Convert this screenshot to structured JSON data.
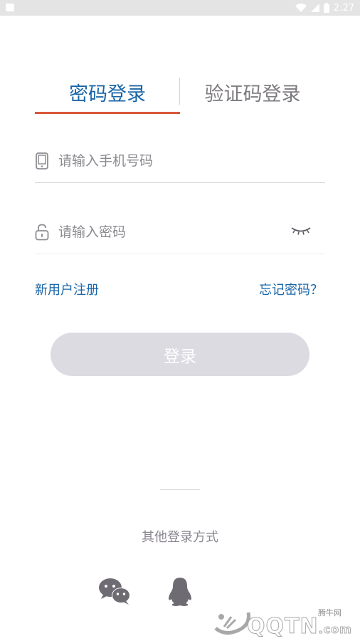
{
  "status_bar": {
    "time": "2:27",
    "icons": [
      "notification-icon",
      "wifi-icon",
      "signal-icon",
      "battery-icon"
    ]
  },
  "tabs": {
    "password_login": "密码登录",
    "code_login": "验证码登录",
    "active": "password_login",
    "accent_color": "#d9573a",
    "active_color": "#1a66a8"
  },
  "form": {
    "phone_placeholder": "请输入手机号码",
    "phone_value": "",
    "password_placeholder": "请输入密码",
    "password_value": ""
  },
  "links": {
    "register": "新用户注册",
    "forgot": "忘记密码？"
  },
  "login_button": "登录",
  "other_login": {
    "label": "其他登录方式",
    "providers": [
      "wechat-icon",
      "qq-icon"
    ]
  },
  "watermark": {
    "brand": "QQTN",
    "suffix": ".com",
    "small_text": "腾牛网"
  }
}
